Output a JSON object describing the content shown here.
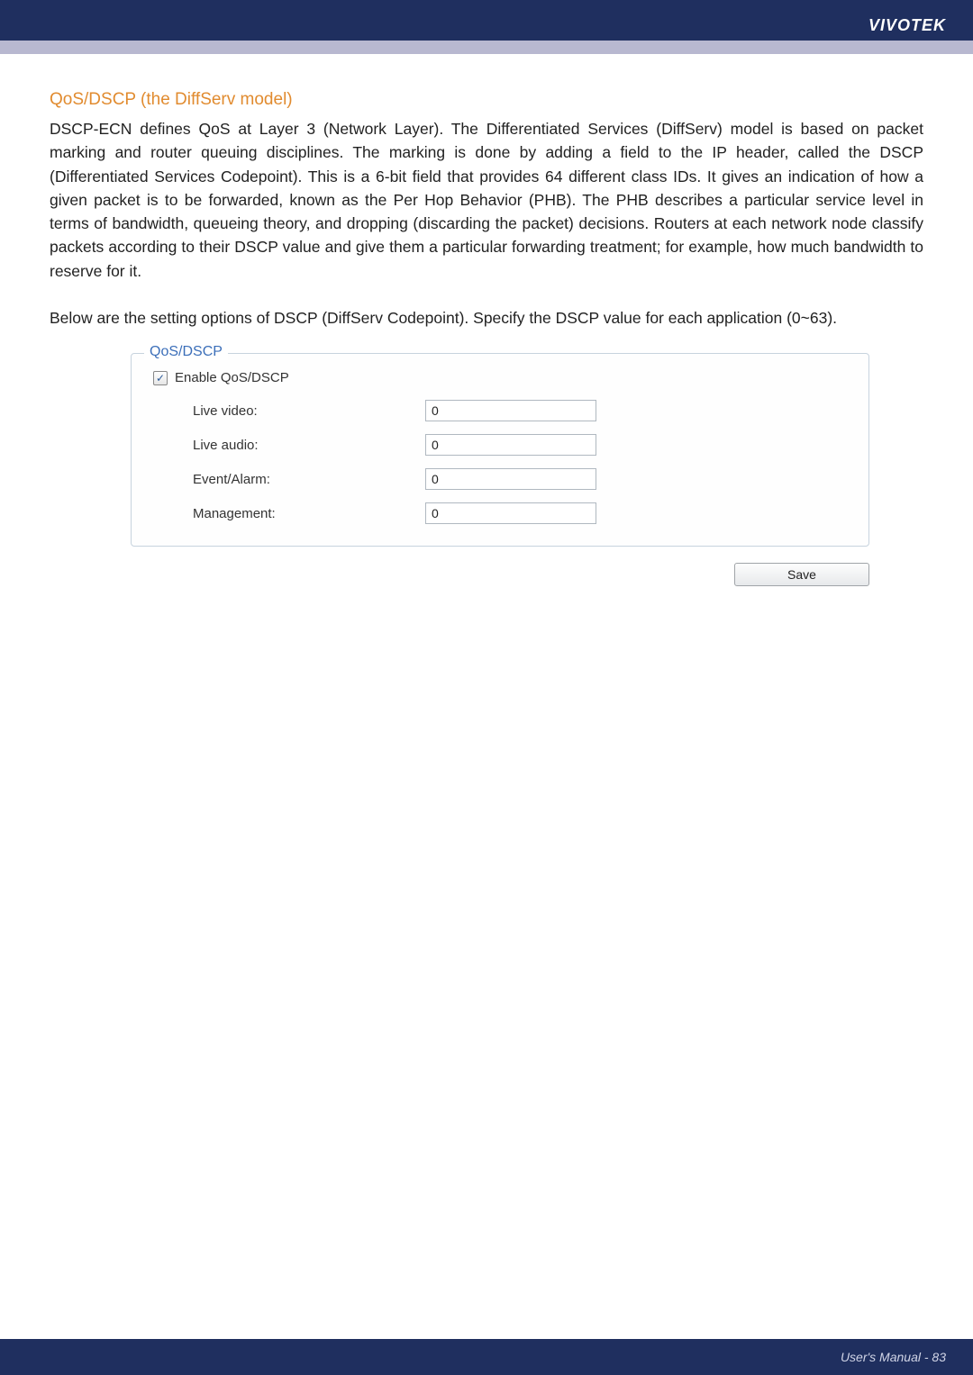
{
  "brand": "VIVOTEK",
  "section_title": "QoS/DSCP (the DiffServ model)",
  "paragraph1": "DSCP-ECN defines QoS at Layer 3 (Network Layer). The Differentiated Services (DiffServ) model is based on packet marking and router queuing disciplines. The marking is done by adding a field to the IP header, called the DSCP (Differentiated Services Codepoint). This is a 6-bit field that provides 64 different class IDs. It gives an indication of how a given packet is to be forwarded, known as the Per Hop Behavior (PHB). The PHB describes a particular service level in terms of bandwidth, queueing theory, and dropping (discarding the packet) decisions. Routers at each network node classify packets according to their DSCP value and give them a particular forwarding treatment; for example, how much bandwidth to reserve for it.",
  "paragraph2": "Below are the setting options of DSCP (DiffServ Codepoint). Specify the DSCP value for each application (0~63).",
  "fieldset": {
    "legend": "QoS/DSCP",
    "enable_label": "Enable QoS/DSCP",
    "rows": [
      {
        "label": "Live video:",
        "value": "0"
      },
      {
        "label": "Live audio:",
        "value": "0"
      },
      {
        "label": "Event/Alarm:",
        "value": "0"
      },
      {
        "label": "Management:",
        "value": "0"
      }
    ]
  },
  "save_label": "Save",
  "footer": "User's Manual - 83"
}
